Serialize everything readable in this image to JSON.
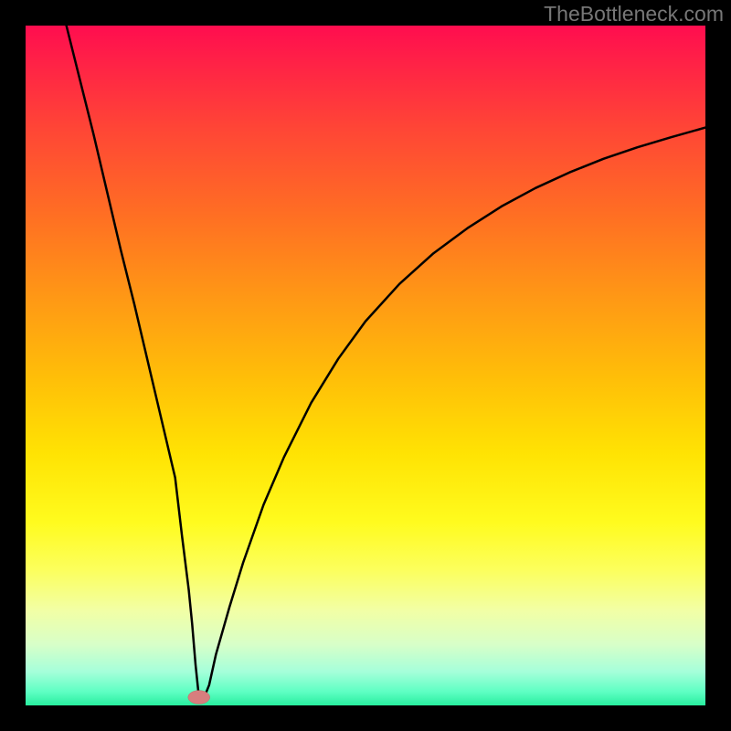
{
  "watermark": "TheBottleneck.com",
  "chart_data": {
    "type": "line",
    "title": "",
    "xlabel": "",
    "ylabel": "",
    "xlim": [
      0,
      100
    ],
    "ylim": [
      0,
      100
    ],
    "grid": false,
    "legend": false,
    "series": [
      {
        "name": "bottleneck-curve",
        "x": [
          6,
          8,
          10,
          12,
          14,
          16,
          18,
          20,
          22,
          23,
          24,
          24.5,
          25,
          25.5,
          26,
          27,
          28,
          30,
          32,
          35,
          38,
          42,
          46,
          50,
          55,
          60,
          65,
          70,
          75,
          80,
          85,
          90,
          95,
          100
        ],
        "y": [
          100,
          92,
          84,
          75.5,
          67,
          59,
          50.5,
          42,
          33.5,
          25,
          17,
          12,
          6,
          1.2,
          0.5,
          3,
          7.5,
          14.5,
          21,
          29.5,
          36.5,
          44.5,
          51,
          56.5,
          62,
          66.5,
          70.2,
          73.4,
          76.1,
          78.4,
          80.4,
          82.1,
          83.6,
          85
        ]
      }
    ],
    "markers": [
      {
        "name": "minimum-point",
        "x": 25.5,
        "y": 1.2,
        "rx": 1.6,
        "ry": 1.0
      }
    ],
    "colors": {
      "curve": "#000000",
      "marker": "#d77e7e",
      "gradient_top": "#ff0d4f",
      "gradient_bottom": "#28ee9f"
    }
  }
}
